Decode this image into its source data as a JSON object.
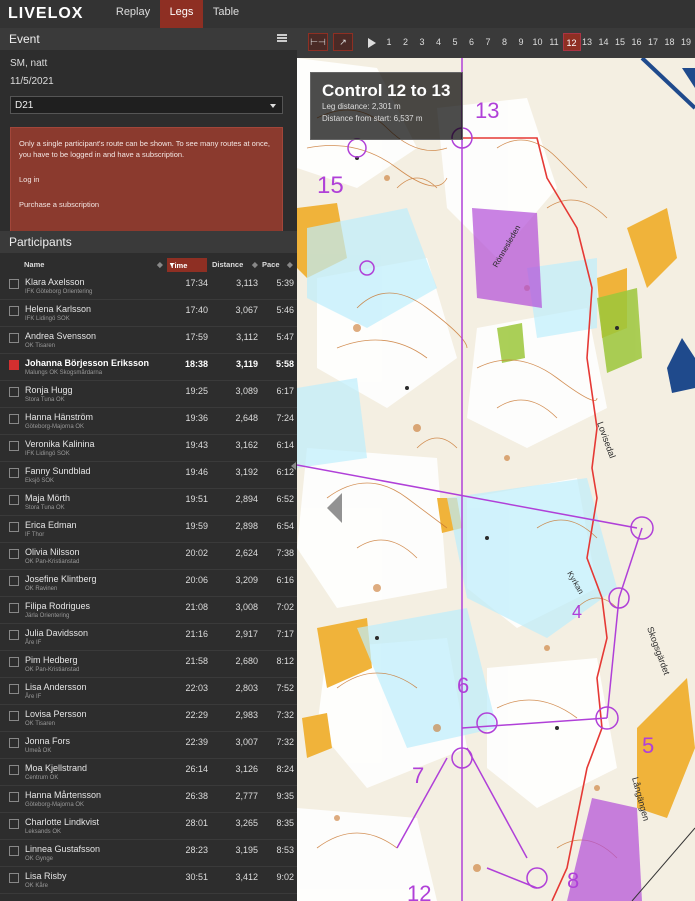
{
  "app": {
    "logo": "LIVELOX"
  },
  "nav": {
    "tabs": [
      {
        "label": "Replay"
      },
      {
        "label": "Legs"
      },
      {
        "label": "Table"
      }
    ]
  },
  "event": {
    "header": "Event",
    "name": "SM, natt",
    "date": "11/5/2021",
    "class_select": "D21",
    "notice": "Only a single participant's route can be shown. To see many routes at once, you have to be logged in and have a subscription.",
    "login_link": "Log in",
    "purchase_link": "Purchase a subscription"
  },
  "participants": {
    "header": "Participants",
    "columns": {
      "name": "Name",
      "time": "Time",
      "distance": "Distance",
      "pace": "Pace"
    },
    "rows": [
      {
        "name": "Klara Axelsson",
        "club": "IFK Göteborg Orientering",
        "time": "17:34",
        "distance": "3,113",
        "pace": "5:39"
      },
      {
        "name": "Helena Karlsson",
        "club": "IFK Lidingö SOK",
        "time": "17:40",
        "distance": "3,067",
        "pace": "5:46"
      },
      {
        "name": "Andrea Svensson",
        "club": "OK Tisaren",
        "time": "17:59",
        "distance": "3,112",
        "pace": "5:47"
      },
      {
        "name": "Johanna Börjesson Eriksson",
        "club": "Malungs OK Skogsmårdarna",
        "time": "18:38",
        "distance": "3,119",
        "pace": "5:58"
      },
      {
        "name": "Ronja Hugg",
        "club": "Stora Tuna OK",
        "time": "19:25",
        "distance": "3,089",
        "pace": "6:17"
      },
      {
        "name": "Hanna Hänström",
        "club": "Göteborg-Majorna OK",
        "time": "19:36",
        "distance": "2,648",
        "pace": "7:24"
      },
      {
        "name": "Veronika Kalinina",
        "club": "IFK Lidingö SOK",
        "time": "19:43",
        "distance": "3,162",
        "pace": "6:14"
      },
      {
        "name": "Fanny Sundblad",
        "club": "Eksjö SOK",
        "time": "19:46",
        "distance": "3,192",
        "pace": "6:12"
      },
      {
        "name": "Maja Mörth",
        "club": "Stora Tuna OK",
        "time": "19:51",
        "distance": "2,894",
        "pace": "6:52"
      },
      {
        "name": "Erica Edman",
        "club": "IF Thor",
        "time": "19:59",
        "distance": "2,898",
        "pace": "6:54"
      },
      {
        "name": "Olivia Nilsson",
        "club": "OK Pan-Kristianstad",
        "time": "20:02",
        "distance": "2,624",
        "pace": "7:38"
      },
      {
        "name": "Josefine Klintberg",
        "club": "OK Ravinen",
        "time": "20:06",
        "distance": "3,209",
        "pace": "6:16"
      },
      {
        "name": "Filipa Rodrigues",
        "club": "Järla Orientering",
        "time": "21:08",
        "distance": "3,008",
        "pace": "7:02"
      },
      {
        "name": "Julia Davidsson",
        "club": "Åre IF",
        "time": "21:16",
        "distance": "2,917",
        "pace": "7:17"
      },
      {
        "name": "Pim Hedberg",
        "club": "OK Pan-Kristianstad",
        "time": "21:58",
        "distance": "2,680",
        "pace": "8:12"
      },
      {
        "name": "Lisa Andersson",
        "club": "Åre IF",
        "time": "22:03",
        "distance": "2,803",
        "pace": "7:52"
      },
      {
        "name": "Lovisa Persson",
        "club": "OK Tisaren",
        "time": "22:29",
        "distance": "2,983",
        "pace": "7:32"
      },
      {
        "name": "Jonna Fors",
        "club": "Umeå OK",
        "time": "22:39",
        "distance": "3,007",
        "pace": "7:32"
      },
      {
        "name": "Moa Kjellstrand",
        "club": "Centrum OK",
        "time": "26:14",
        "distance": "3,126",
        "pace": "8:24"
      },
      {
        "name": "Hanna Mårtensson",
        "club": "Göteborg-Majorna OK",
        "time": "26:38",
        "distance": "2,777",
        "pace": "9:35"
      },
      {
        "name": "Charlotte Lindkvist",
        "club": "Leksands OK",
        "time": "28:01",
        "distance": "3,265",
        "pace": "8:35"
      },
      {
        "name": "Linnea Gustafsson",
        "club": "OK Gynge",
        "time": "28:23",
        "distance": "3,195",
        "pace": "8:53"
      },
      {
        "name": "Lisa Risby",
        "club": "OK Kåre",
        "time": "30:51",
        "distance": "3,412",
        "pace": "9:02"
      }
    ]
  },
  "legs": {
    "items": [
      "1",
      "2",
      "3",
      "4",
      "5",
      "6",
      "7",
      "8",
      "9",
      "10",
      "11",
      "12",
      "13",
      "14",
      "15",
      "16",
      "17",
      "18",
      "19"
    ],
    "active": "12"
  },
  "leg_info": {
    "title": "Control 12 to 13",
    "leg_distance": "Leg distance: 2,301 m",
    "distance_from_start": "Distance from start: 6,537 m"
  },
  "map": {
    "labels": {
      "lovisedal": "Lovisedal",
      "skogsgardet": "Skogsgärdet",
      "langangen": "Långängen",
      "kyrkan": "Kyrkan",
      "ronnesleden": "Rönnesleden"
    },
    "control_numbers": {
      "c13": "13",
      "c15": "15",
      "c5": "5",
      "c4": "4",
      "c6": "6",
      "c7": "7",
      "c8": "8",
      "c12": "12"
    },
    "colors": {
      "route": "#e53935",
      "course": "#b040d8",
      "forest": "#ffffff",
      "terrain": "#f3f0e6",
      "open": "#f2b636"
    }
  }
}
